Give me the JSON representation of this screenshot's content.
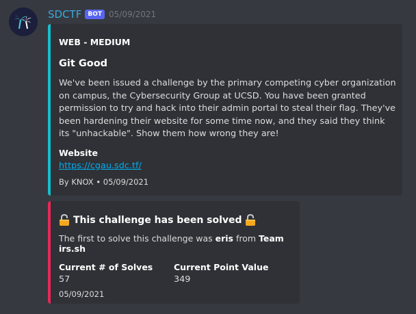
{
  "message": {
    "username": "SDCTF",
    "bot_tag": "BOT",
    "timestamp": "05/09/2021",
    "avatar_icon": "palm-tree-icon"
  },
  "embed1": {
    "accent_color": "#15bfd0",
    "author": "WEB - MEDIUM",
    "title": "Git Good",
    "description": "We've been issued a challenge by the primary competing cyber organization on campus, the Cybersecurity Group at UCSD. You have been granted permission to try and hack into their admin portal to steal their flag. They've been hardening their website for some time now, and they said they think its \"unhackable\". Show them how wrong they are!",
    "field_name": "Website",
    "field_link": "https://cgau.sdc.tf/",
    "footer": "By KNOX • 05/09/2021"
  },
  "embed2": {
    "accent_color": "#e92758",
    "title": "This challenge has been solved",
    "lock_icon": "unlocked-padlock-icon",
    "desc_prefix": "The first to solve this challenge was ",
    "solver": "eris",
    "desc_mid": " from ",
    "team": "Team irs.sh",
    "solves_label": "Current # of Solves",
    "solves_value": "57",
    "points_label": "Current Point Value",
    "points_value": "349",
    "date": "05/09/2021"
  }
}
